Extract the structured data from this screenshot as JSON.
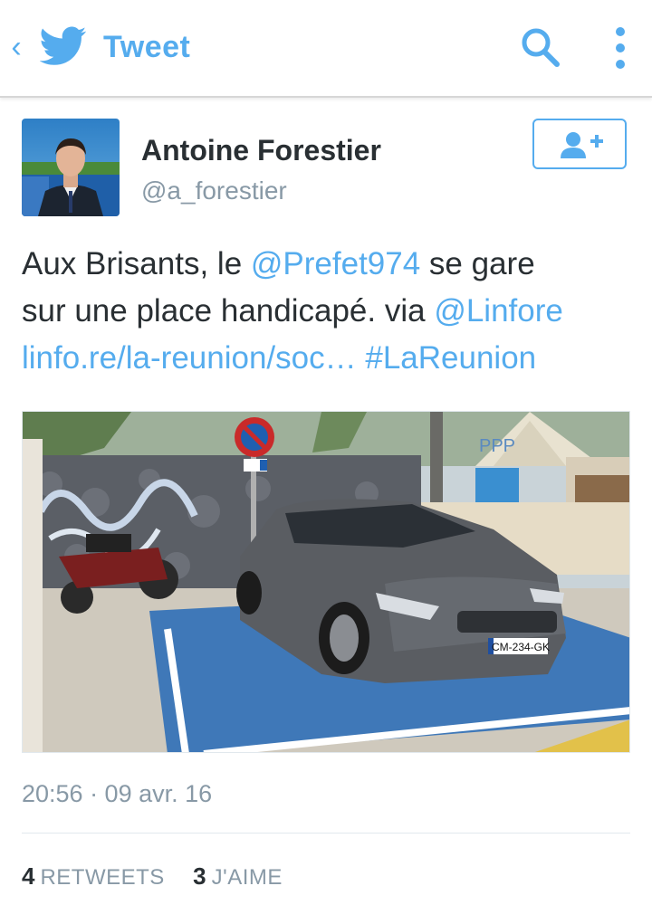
{
  "header": {
    "back_glyph": "‹",
    "title": "Tweet",
    "icons": [
      "chevron-left-icon",
      "twitter-bird-icon",
      "search-icon",
      "more-vertical-icon"
    ],
    "accent_color": "#55acee"
  },
  "author": {
    "name": "Antoine Forestier",
    "handle": "@a_forestier",
    "follow_icon": "add-user-icon"
  },
  "tweet": {
    "text_1": "Aux Brisants, le ",
    "mention_1": "@Prefet974",
    "text_2": " se gare",
    "text_3": "sur une place handicapé. via ",
    "mention_2": "@Linfore",
    "link": "linfo.re/la-reunion/soc…",
    "hashtag": "#LaReunion"
  },
  "photo": {
    "plate": "CM-234-GK",
    "sign_text": "PPP"
  },
  "meta": {
    "timestamp": "20:56 · 09 avr. 16"
  },
  "stats": {
    "retweets_count": "4",
    "retweets_label": "RETWEETS",
    "likes_count": "3",
    "likes_label": "J'AIME"
  }
}
